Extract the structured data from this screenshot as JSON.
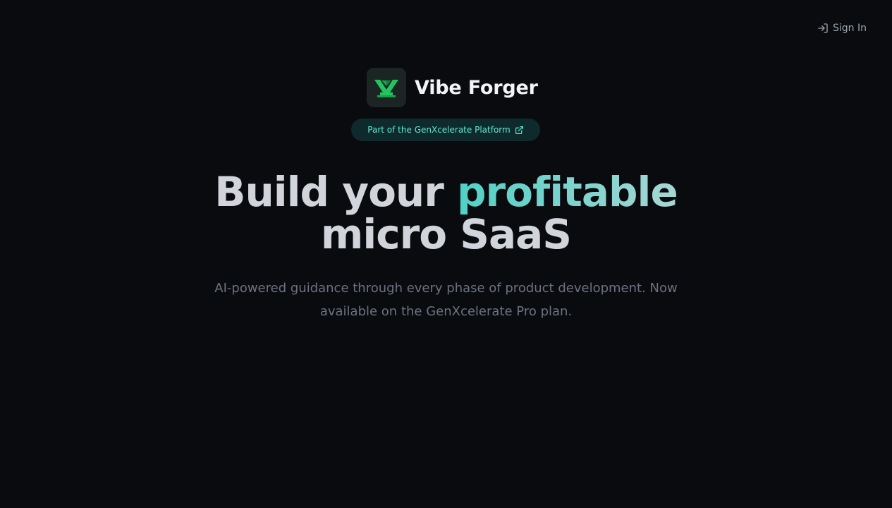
{
  "header": {
    "sign_in_label": "Sign In",
    "sign_in_icon": "log-in-icon"
  },
  "brand": {
    "name": "Vibe Forger",
    "logo_icon": "vibe-forger-logo-icon"
  },
  "platform_badge": {
    "label": "Part of the GenXcelerate Platform",
    "icon": "external-link-icon"
  },
  "hero": {
    "title_part1": "Build your ",
    "title_accent": "profitable",
    "title_part2": "micro SaaS"
  },
  "subtitle": "AI-powered guidance through every phase of product development. Now available on the GenXcelerate Pro plan.",
  "colors": {
    "background": "#0a0b0f",
    "accent": "#4fd1c5",
    "logo_green": "#22c55e",
    "pill_bg": "#0f2a2c"
  }
}
